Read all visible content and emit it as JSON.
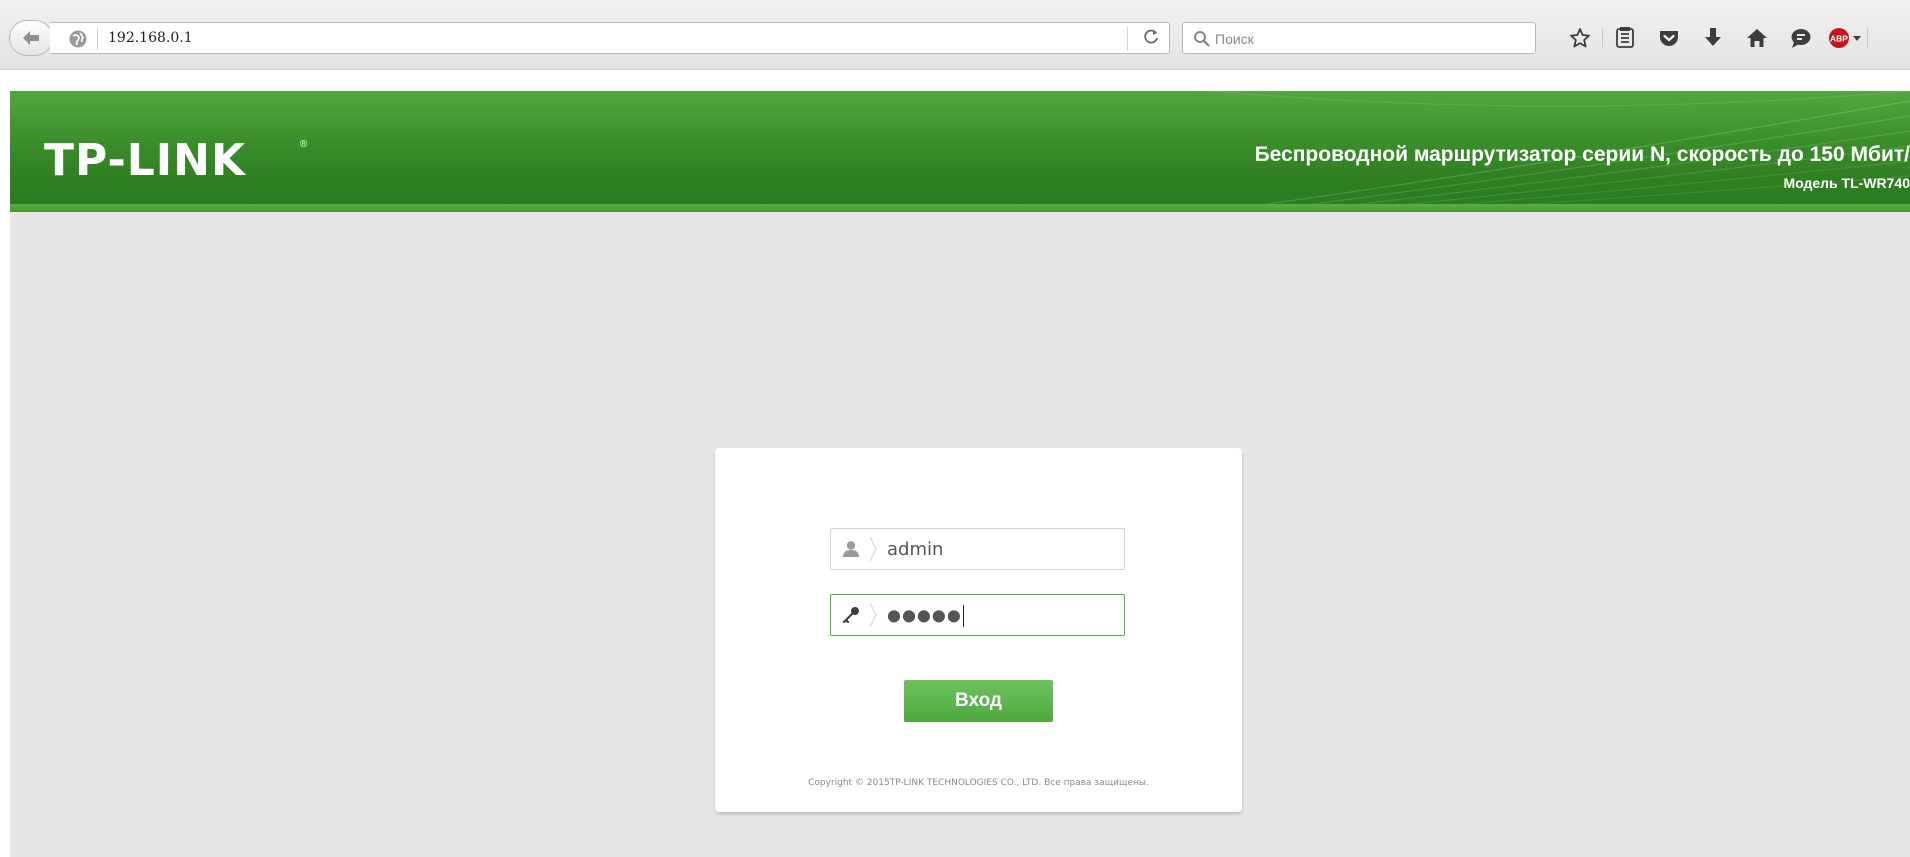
{
  "browser": {
    "url": "192.168.0.1",
    "search_placeholder": "Поиск",
    "icons": [
      "back-arrow-icon",
      "globe-icon",
      "reload-icon",
      "search-icon",
      "bookmark-star-icon",
      "reading-list-icon",
      "pocket-icon",
      "download-icon",
      "home-icon",
      "chat-icon",
      "adblock-icon"
    ],
    "adblock_label": "ABP"
  },
  "header": {
    "logo": "TP-LINK",
    "logo_mark": "®",
    "title": "Беспроводной маршрутизатор серии N, скорость до 150 Мбит/",
    "model": "Модель TL-WR740",
    "color_top": "#52a83f",
    "color_bottom": "#2a7a1e"
  },
  "login": {
    "username_value": "admin",
    "password_masked": "●●●●●",
    "submit_label": "Вход",
    "copyright": "Copyright © 2015TP-LINK TECHNOLOGIES CO., LTD. Все права защищены.",
    "accent_color": "#55a94a"
  }
}
